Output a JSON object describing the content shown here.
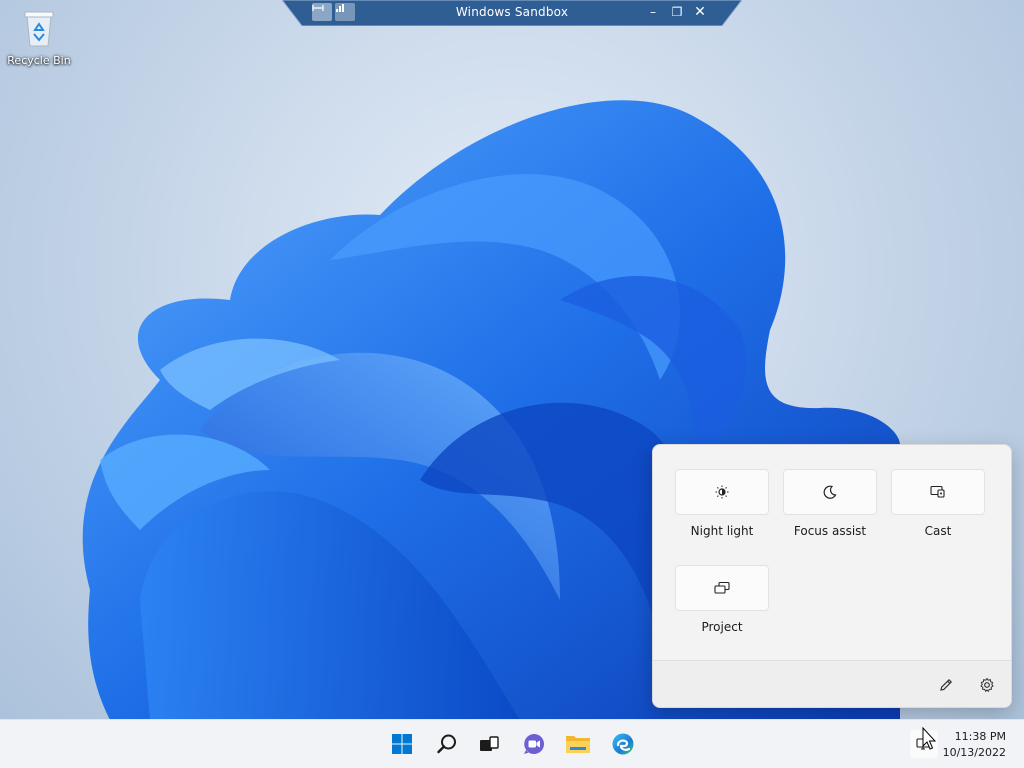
{
  "sandbox": {
    "title": "Windows Sandbox",
    "minimize_symbol": "–",
    "restore_symbol": "❐",
    "close_symbol": "✕"
  },
  "desktop": {
    "icons": [
      {
        "label": "Recycle Bin",
        "icon": "recycle-bin-icon"
      }
    ]
  },
  "quick_settings": {
    "tiles": [
      {
        "label": "Night light",
        "icon": "night-light-icon"
      },
      {
        "label": "Focus assist",
        "icon": "moon-icon"
      },
      {
        "label": "Cast",
        "icon": "cast-icon"
      },
      {
        "label": "Project",
        "icon": "project-icon"
      }
    ],
    "footer": {
      "edit_icon": "pencil-icon",
      "settings_icon": "gear-icon"
    }
  },
  "taskbar": {
    "items": [
      {
        "name": "start",
        "icon": "windows-logo-icon"
      },
      {
        "name": "search",
        "icon": "search-icon"
      },
      {
        "name": "task-view",
        "icon": "task-view-icon"
      },
      {
        "name": "chat",
        "icon": "teams-chat-icon"
      },
      {
        "name": "file-explorer",
        "icon": "folder-icon"
      },
      {
        "name": "edge",
        "icon": "edge-icon"
      }
    ],
    "clock": {
      "time": "11:38 PM",
      "date": "10/13/2022"
    }
  },
  "colors": {
    "accent": "#0078d4",
    "bloom_dark": "#0a3fb8",
    "bloom_light": "#3c8cf5",
    "sandbox_bar": "#2f5e95"
  }
}
